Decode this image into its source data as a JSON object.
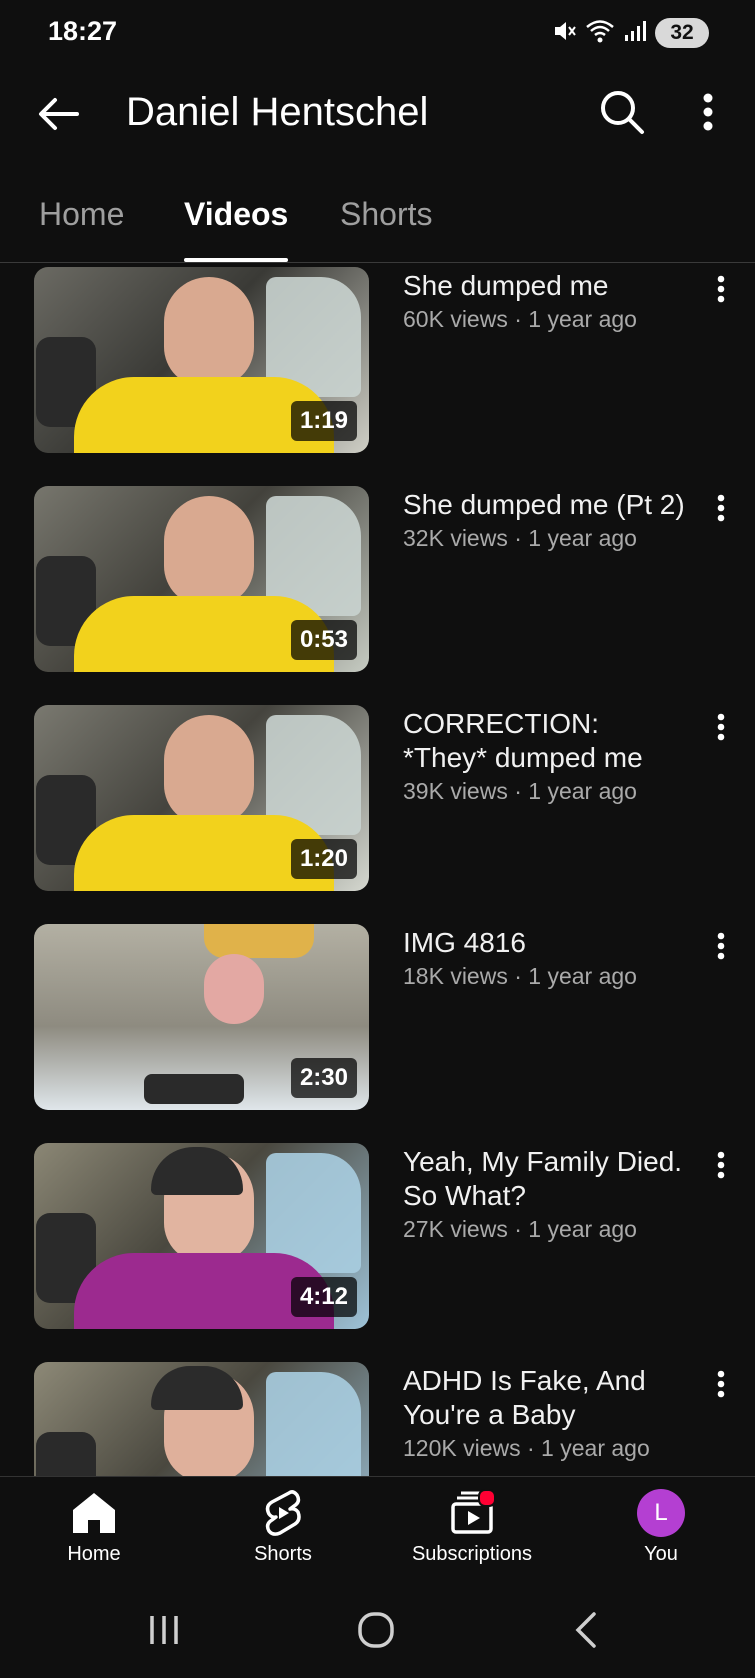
{
  "status_bar": {
    "time": "18:27",
    "battery": "32",
    "icons": [
      "mute-icon",
      "wifi-icon",
      "signal-icon"
    ]
  },
  "header": {
    "channel_name": "Daniel Hentschel",
    "icons": [
      "back-arrow-icon",
      "search-icon",
      "more-vert-icon"
    ]
  },
  "tabs": [
    {
      "label": "Home",
      "active": false
    },
    {
      "label": "Videos",
      "active": true
    },
    {
      "label": "Shorts",
      "active": false
    }
  ],
  "videos": [
    {
      "title": "She dumped me",
      "meta": "60K views · 1 year ago",
      "duration": "1:19",
      "clothing_color": "#f2d21c"
    },
    {
      "title": "She dumped me (Pt 2)",
      "meta": "32K views · 1 year ago",
      "duration": "0:53",
      "clothing_color": "#f2d21c"
    },
    {
      "title": "CORRECTION: *They* dumped me",
      "meta": "39K views · 1 year ago",
      "duration": "1:20",
      "clothing_color": "#f2d21c"
    },
    {
      "title": "IMG 4816",
      "meta": "18K views · 1 year ago",
      "duration": "2:30",
      "clothing_color": "#8a8a8a"
    },
    {
      "title": "Yeah, My Family Died. So What?",
      "meta": "27K views · 1 year ago",
      "duration": "4:12",
      "clothing_color": "#9c2a8f"
    },
    {
      "title": "ADHD Is Fake, And You're a Baby",
      "meta": "120K views · 1 year ago",
      "duration": "",
      "clothing_color": "#f2d21c"
    }
  ],
  "bottom_nav": [
    {
      "label": "Home",
      "icon": "home-icon"
    },
    {
      "label": "Shorts",
      "icon": "shorts-icon"
    },
    {
      "label": "Subscriptions",
      "icon": "subscriptions-icon"
    },
    {
      "label": "You",
      "icon": "avatar",
      "avatar_letter": "L"
    }
  ],
  "colors": {
    "background": "#0f0f0f",
    "text": "#f1f1f1",
    "meta_text": "#aaaaaa",
    "avatar": "#b43fd2",
    "notification": "#ff0033"
  }
}
